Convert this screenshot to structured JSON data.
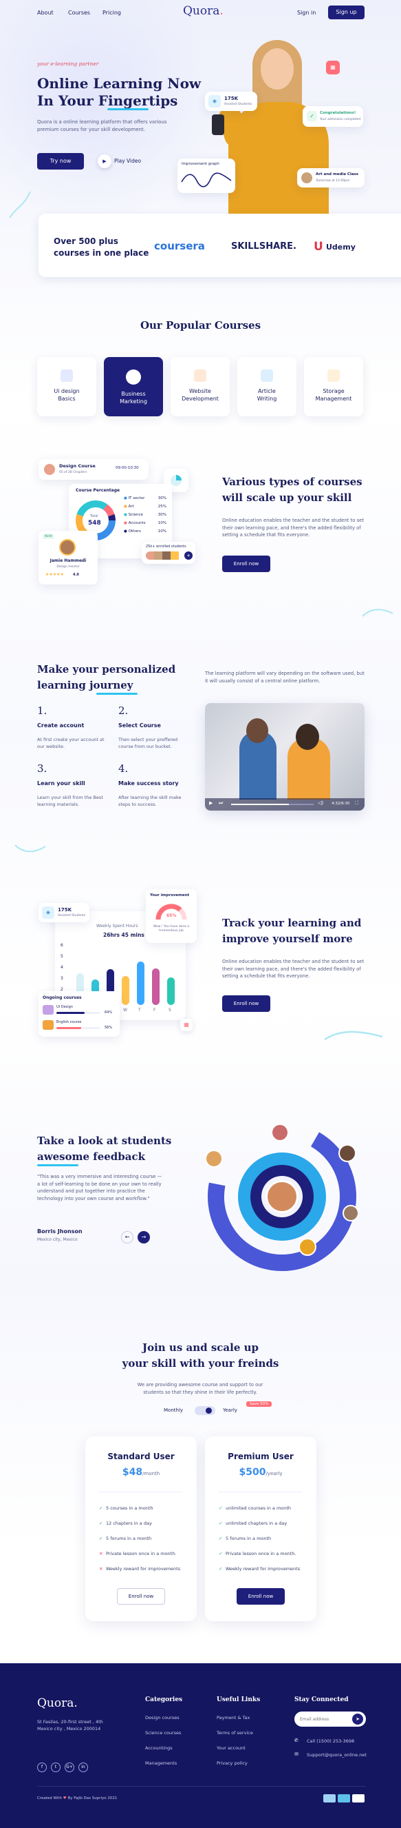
{
  "nav": {
    "about": "About",
    "courses": "Courses",
    "pricing": "Pricing",
    "logo": "Quora",
    "signin": "Sign in",
    "signup": "Sign up"
  },
  "hero": {
    "tagline": "your e-learning partner",
    "title_line1": "Online Learning Now",
    "title_line2": "In Your Fingertips",
    "desc": "Quora is a online learning platform that offers various premium courses for your skill development.",
    "try_btn": "Try now",
    "play_btn": "Play Video",
    "stat_value": "175K",
    "stat_label": "Assisted Students",
    "congrats_title": "Congratulations!",
    "congrats_sub": "Your admission completed",
    "graph_label": "Improvement graph",
    "class_title": "Art and media Class",
    "class_sub": "Tomorrow at 12:00pm"
  },
  "partners": {
    "title": "Over 500 plus courses in one place",
    "p1": "coursera",
    "p2": "SKILLSHARE.",
    "p3": "Udemy"
  },
  "popular": {
    "title": "Our Popular Courses",
    "items": [
      {
        "label": "Ui design Basics"
      },
      {
        "label": "Business Marketing"
      },
      {
        "label": "Website Development"
      },
      {
        "label": "Article Writing"
      },
      {
        "label": "Storage Management"
      }
    ]
  },
  "scale": {
    "design_course": "Design Course",
    "design_sub": "05 of 28 Chapters",
    "design_time": "09:00-10:30",
    "course_pct_title": "Course Percentage",
    "donut_total": "Total",
    "donut_value": "548",
    "legend": [
      {
        "name": "IT sector",
        "pct": "30%"
      },
      {
        "name": "Art",
        "pct": "25%"
      },
      {
        "name": "Science",
        "pct": "30%"
      },
      {
        "name": "Accounts",
        "pct": "10%"
      },
      {
        "name": "Others",
        "pct": "10%"
      }
    ],
    "badge": "NEW",
    "teacher_name": "Jamie Hammedi",
    "teacher_role": "Design mentor",
    "teacher_rating": "4.9",
    "enrolled": "25k+ enrolled students",
    "title_line1": "Various types of courses",
    "title_line2": "will scale up your skill",
    "desc": "Online education enables the teacher and the student to set their own learning pace, and there's the added flexibility of setting a schedule that fits everyone.",
    "enroll_btn": "Enroll now"
  },
  "journey": {
    "title_line1": "Make your personalized",
    "title_line2": "learning journey",
    "intro": "The learning platform will vary depending on the software used, but it will usually consist of a central online platform.",
    "steps": [
      {
        "num": "1.",
        "title": "Create account",
        "desc": "At first create your account at our website."
      },
      {
        "num": "2.",
        "title": "Select Course",
        "desc": "Then select your preffered course from our bucket."
      },
      {
        "num": "3.",
        "title": "Learn your skill",
        "desc": "Learn your skill from the Best learning materials."
      },
      {
        "num": "4.",
        "title": "Make success story",
        "desc": "After learning the skill make steps to success."
      }
    ],
    "video_time": "4:32/6:30"
  },
  "track": {
    "stat_value": "175K",
    "stat_label": "Assisted Students",
    "improvement_title": "Your improvement",
    "improvement_pct": "65%",
    "improvement_sub": "Wow ! You have done a tremendous job",
    "weekly_label": "Weekly Spent Hours",
    "weekly_value": "26hrs 45 mins",
    "yticks": [
      "6",
      "5",
      "4",
      "3",
      "2",
      "1"
    ],
    "days": [
      "S",
      "M",
      "T",
      "W",
      "T",
      "F",
      "S"
    ],
    "hours": [
      3.2,
      2.6,
      3.6,
      2.9,
      4.4,
      3.7,
      2.8
    ],
    "bar_colors": [
      "#d8f0f6",
      "#33c2d6",
      "#1e1f7a",
      "#ffc24d",
      "#3aa8ff",
      "#c85a9d",
      "#2cc7b2"
    ],
    "ongoing_title": "Ongoing courses",
    "ongoing": [
      {
        "name": "UI Design",
        "pct": "64%"
      },
      {
        "name": "English course",
        "pct": "56%"
      }
    ],
    "title_line1": "Track your learning and",
    "title_line2": "improve yourself more",
    "desc": "Online education enables the teacher and the student to set their own learning pace, and there's the added flexibility of setting a schedule that fits everyone.",
    "enroll_btn": "Enroll now"
  },
  "feedback": {
    "title_line1": "Take a look at students",
    "title_line2": "awesome feedback",
    "quote": "\"This was a very immersive and interesting course — a lot of self-learning to be done on your own to really understand and put together into practice the technology into your own course and workflow.\"",
    "name": "Borris Jhonson",
    "place": "Mexico city, Mexico"
  },
  "pricing": {
    "title_line1": "Join us and scale up",
    "title_line2": "your skill with your freinds",
    "desc": "We are providing awesome course and support to our students so that they shine in their life perfectly.",
    "monthly": "Monthly",
    "yearly": "Yearly",
    "save": "Save 50%",
    "plans": [
      {
        "name": "Standard User",
        "price": "$48",
        "per": "/month",
        "button": "Enroll now",
        "features": [
          {
            "text": "5 courses in a month",
            "ok": true
          },
          {
            "text": "12 chapters in a day",
            "ok": true
          },
          {
            "text": "5 forums in a month",
            "ok": true
          },
          {
            "text": "Private lesson once in a month.",
            "ok": false
          },
          {
            "text": "Weekly reward for improvements",
            "ok": false
          }
        ]
      },
      {
        "name": "Premium User",
        "price": "$500",
        "per": "/yearly",
        "button": "Enroll now",
        "features": [
          {
            "text": "unlimited courses in a month",
            "ok": true
          },
          {
            "text": "unlimited chapters in a day",
            "ok": true
          },
          {
            "text": "5 forums in a month",
            "ok": true
          },
          {
            "text": "Private lesson once in a month.",
            "ok": true
          },
          {
            "text": "Weekly reward for improvements",
            "ok": true
          }
        ]
      }
    ]
  },
  "footer": {
    "logo": "Quora.",
    "address": "St Fasilas, 20-first street , 4th Mexico city , Mexico 200014",
    "categories_title": "Categories",
    "categories": [
      "Design courses",
      "Science courses",
      "Accountings",
      "Managements"
    ],
    "links_title": "Useful Links",
    "links": [
      "Payment & Tax",
      "Terms of service",
      "Your account",
      "Privacy policy"
    ],
    "contact_title": "Stay Connected",
    "email_placeholder": "Email address",
    "phone": "Call (1500) 253-3698",
    "email": "Support@quora_online.net",
    "socials": [
      "f",
      "t",
      "G+",
      "in"
    ],
    "credit": "Created With",
    "copyright": "By Fajib Das Supriyo 2021"
  }
}
